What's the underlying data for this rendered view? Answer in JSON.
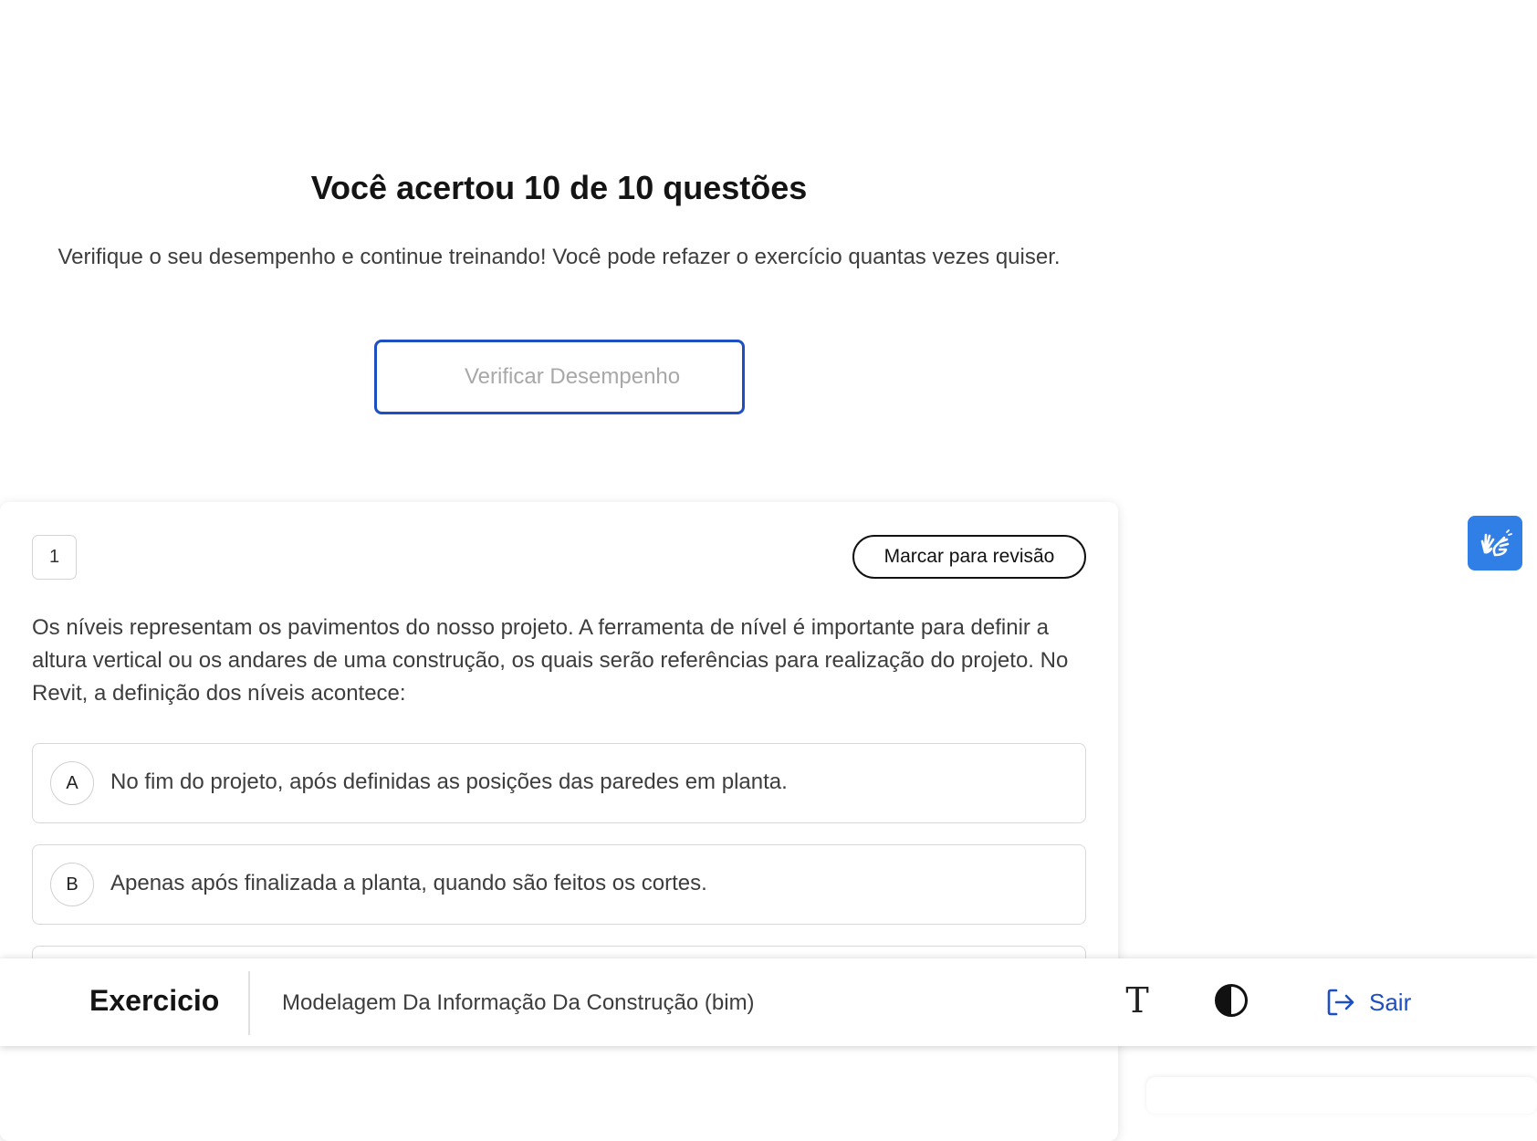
{
  "result": {
    "title": "Você acertou 10 de 10 questões",
    "subtitle": "Verifique o seu desempenho e continue treinando! Você pode refazer o exercício quantas vezes quiser.",
    "check_button_label": "Verificar Desempenho"
  },
  "question": {
    "number": "1",
    "review_button_label": "Marcar para revisão",
    "text": "Os níveis representam os pavimentos do nosso projeto. A ferramenta de nível é importante para definir a altura vertical ou os andares de uma construção, os quais serão referências para realização do projeto. No Revit, a definição dos níveis acontece:",
    "options": [
      {
        "letter": "A",
        "text": "No fim do projeto, após definidas as posições das paredes em planta."
      },
      {
        "letter": "B",
        "text": "Apenas após finalizada a planta, quando são feitos os cortes."
      }
    ]
  },
  "bottom_bar": {
    "title": "Exercicio",
    "course": "Modelagem Da Informação Da Construção (bim)",
    "font_size_icon": "T",
    "exit_label": "Sair"
  },
  "icons": {
    "libras": "hands-sign-language-icon",
    "font_size": "text-size-icon",
    "contrast": "contrast-icon",
    "exit": "logout-icon"
  },
  "colors": {
    "primary_blue": "#1e4fc2",
    "libras_blue": "#2f7fe6",
    "text_gray": "#3d3d3d"
  }
}
